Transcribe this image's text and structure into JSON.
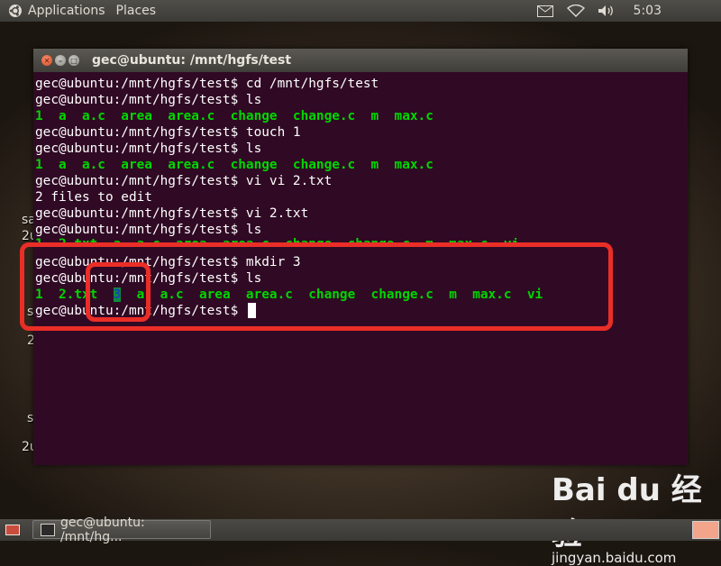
{
  "top_panel": {
    "menu": [
      "Applications",
      "Places"
    ],
    "clock": "5:03",
    "icons": [
      "ubuntu-logo-icon",
      "mail-icon",
      "wifi-icon",
      "volume-icon"
    ]
  },
  "desktop": {
    "partial_labels": [
      "sa",
      "2u",
      "s",
      "2",
      "s",
      "2u"
    ]
  },
  "window": {
    "title": "gec@ubuntu: /mnt/hgfs/test",
    "buttons": [
      "close",
      "minimize",
      "maximize"
    ]
  },
  "terminal": {
    "prompt": "gec@ubuntu:/mnt/hgfs/test$",
    "lines": [
      {
        "type": "cmd",
        "text": "cd /mnt/hgfs/test"
      },
      {
        "type": "cmd",
        "text": "ls"
      },
      {
        "type": "ls",
        "text": "1  a  a.c  area  area.c  change  change.c  m  max.c"
      },
      {
        "type": "cmd",
        "text": "touch 1"
      },
      {
        "type": "cmd",
        "text": "ls"
      },
      {
        "type": "ls",
        "text": "1  a  a.c  area  area.c  change  change.c  m  max.c"
      },
      {
        "type": "cmd",
        "text": "vi vi 2.txt"
      },
      {
        "type": "out",
        "text": "2 files to edit"
      },
      {
        "type": "cmd",
        "text": "vi 2.txt"
      },
      {
        "type": "cmd",
        "text": "ls"
      },
      {
        "type": "partial",
        "text": "1  2.txt  a  a.c  area  area.c  change  change.c  m  max.c  vi"
      },
      {
        "type": "cmd",
        "text": "mkdir 3"
      },
      {
        "type": "cmd",
        "text": "ls"
      }
    ],
    "last_ls": {
      "before": "1  2.txt  ",
      "highlight": "3",
      "after": "  a  a.c  area  area.c  change  change.c  m  max.c  vi"
    },
    "final_prompt": "gec@ubuntu:/mnt/hgfs/test$ "
  },
  "watermark": {
    "logo": "Bai du 经验",
    "url": "jingyan.baidu.com"
  },
  "bottom_panel": {
    "task_label": "gec@ubuntu: /mnt/hg..."
  },
  "colors": {
    "terminal_bg": "#300a24",
    "ls_green": "#00d700",
    "highlight_bg": "#0b8c3c",
    "annotation_red": "#ea2e27"
  }
}
